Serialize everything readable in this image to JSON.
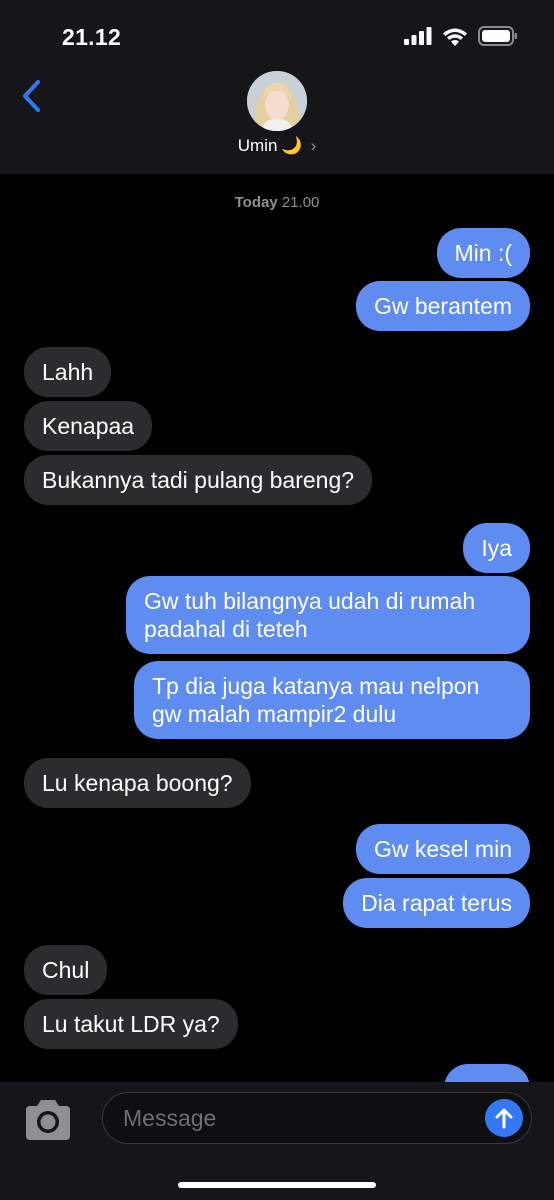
{
  "status_bar": {
    "time": "21.12"
  },
  "header": {
    "contact_name": "Umin",
    "contact_emoji": "🌙",
    "chevron": "›"
  },
  "conversation": {
    "timestamp_day": "Today",
    "timestamp_time": "21.00",
    "messages": [
      {
        "from": "me",
        "text": "Min :("
      },
      {
        "from": "me",
        "text": "Gw berantem"
      },
      {
        "from": "them",
        "text": "Lahh"
      },
      {
        "from": "them",
        "text": "Kenapaa"
      },
      {
        "from": "them",
        "text": "Bukannya tadi pulang bareng?"
      },
      {
        "from": "me",
        "text": "Iya"
      },
      {
        "from": "me",
        "text": "Gw tuh bilangnya udah di rumah padahal di teteh"
      },
      {
        "from": "me",
        "text": "Tp dia juga katanya mau nelpon gw malah mampir2 dulu"
      },
      {
        "from": "them",
        "text": "Lu kenapa boong?"
      },
      {
        "from": "me",
        "text": "Gw kesel min"
      },
      {
        "from": "me",
        "text": "Dia rapat terus"
      },
      {
        "from": "them",
        "text": "Chul"
      },
      {
        "from": "them",
        "text": "Lu takut LDR ya?"
      }
    ]
  },
  "input_bar": {
    "placeholder": "Message"
  },
  "colors": {
    "sent_bubble": "#5e8cf0",
    "received_bubble": "#2c2c2e",
    "accent": "#3478f6"
  }
}
